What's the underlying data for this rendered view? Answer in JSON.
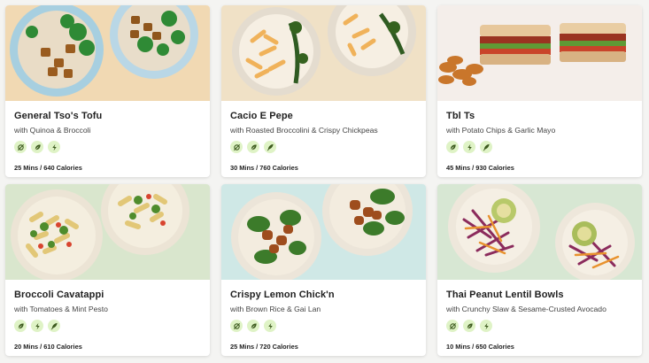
{
  "colors": {
    "badge_bg": "#dff3c6",
    "badge_icon": "#3d5a1e",
    "card_bg": "#ffffff",
    "page_bg": "#f4f4f2"
  },
  "meals": [
    {
      "title": "General Tso's Tofu",
      "subtitle": "with Quinoa & Broccoli",
      "meta": "25 Mins / 640 Calories",
      "badges": [
        "no-meat-icon",
        "leaf-icon",
        "lightning-icon"
      ],
      "image_bg": "#f1d9b3"
    },
    {
      "title": "Cacio E Pepe",
      "subtitle": "with Roasted Broccolini & Crispy Chickpeas",
      "meta": "30 Mins / 760 Calories",
      "badges": [
        "no-meat-icon",
        "leaf-icon",
        "feather-icon"
      ],
      "image_bg": "#f0e1c6"
    },
    {
      "title": "Tbl Ts",
      "subtitle": "with Potato Chips & Garlic Mayo",
      "meta": "45 Mins / 930 Calories",
      "badges": [
        "leaf-icon",
        "lightning-icon",
        "feather-icon"
      ],
      "image_bg": "#f4eeea"
    },
    {
      "title": "Broccoli Cavatappi",
      "subtitle": "with Tomatoes & Mint Pesto",
      "meta": "20 Mins / 610 Calories",
      "badges": [
        "leaf-icon",
        "lightning-icon",
        "feather-icon"
      ],
      "image_bg": "#d9e6cd"
    },
    {
      "title": "Crispy Lemon Chick'n",
      "subtitle": "with Brown Rice & Gai Lan",
      "meta": "25 Mins / 720 Calories",
      "badges": [
        "no-meat-icon",
        "leaf-icon",
        "lightning-icon"
      ],
      "image_bg": "#cfe8e6"
    },
    {
      "title": "Thai Peanut Lentil Bowls",
      "subtitle": "with Crunchy Slaw & Sesame-Crusted Avocado",
      "meta": "10 Mins / 650 Calories",
      "badges": [
        "no-meat-icon",
        "leaf-icon",
        "lightning-icon"
      ],
      "image_bg": "#d7e7d3"
    }
  ]
}
